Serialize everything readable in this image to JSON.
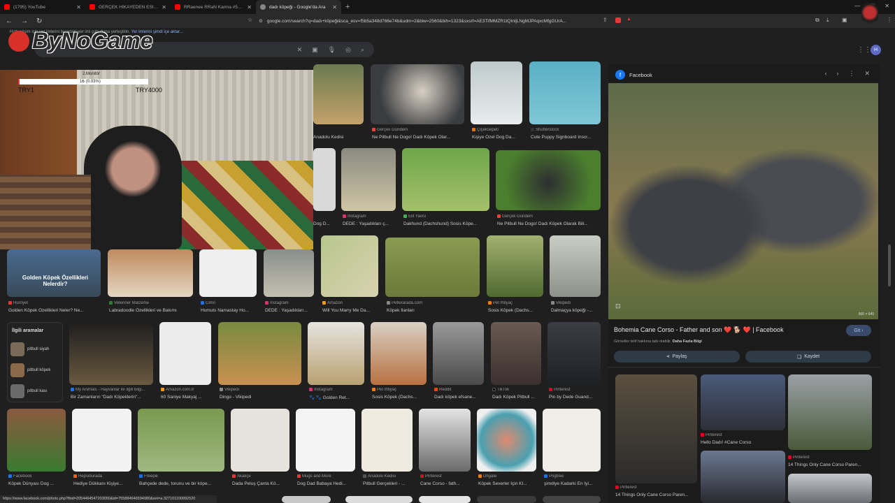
{
  "tabs": [
    {
      "title": "(1795) YouTube",
      "color": "#ff0000"
    },
    {
      "title": "GERÇEK HİKAYEDEN ESİNLENEN TÜRK",
      "color": "#ff0000"
    },
    {
      "title": "RRaenee RRaN Karma #58 İstiyor - YouTube",
      "color": "#ff0000"
    },
    {
      "title": "dadı köpeği - Google'da Ara",
      "color": "#888888",
      "active": true
    }
  ],
  "new_tab": "+",
  "address": {
    "url": "google.com/search?q=dadı+köpeği&sca_esv=f5b5a348d766e74b&udm=2&biw=2560&bih=1323&sxsrf=AE3TifMMZR1tQInljLNgMJPAqxcMfgGUrA..."
  },
  "bookmarks": {
    "text": "Hızlı erişim için yer imlerini buradaki yer imi çubuğuna yerleştirin.",
    "link": "Yer imlerini şimdi içe aktar..."
  },
  "overlay": {
    "logo": "ByNoGame",
    "monitor": "2.Monitör",
    "percent": "1₺ (0.03%)",
    "left": "TRY1",
    "right": "TRY4000"
  },
  "results": [
    {
      "src": "Gerçek Gündem",
      "title": "Ne Pitbull Ne Dogo! Dadı Köpek Olar...",
      "c": "#ea4335"
    },
    {
      "src": "Çiçeksepeti",
      "title": "Kişiye Özel Dog Da...",
      "c": "#e37400"
    },
    {
      "src": "Shutterstock",
      "title": "Cute Puppy Signboard Inscr...",
      "c": "#333"
    },
    {
      "src": "",
      "title": "Anadolu Kedisi",
      "c": "#555"
    },
    {
      "src": "Instagram",
      "title": "DEDE : Yaşadıkları ç...",
      "c": "#e1306c"
    },
    {
      "src": "Elit Yavru",
      "title": "Dakhund (Dachshund) Sosis Köpe...",
      "c": "#4caf50"
    },
    {
      "src": "Gerçek Gündem",
      "title": "Ne Pitbull Ne Dogo! Dadı Köpek Olarak Bili...",
      "c": "#ea4335"
    },
    {
      "src": "",
      "title": "Dog D...",
      "c": "#555"
    },
    {
      "src": "Hürriyet",
      "title": "Golden Köpek Özellikleri Neler? Ne...",
      "c": "#e53935"
    },
    {
      "src": "Veteriner Malzeme",
      "title": "Labradoodle Özellikleri ve Bakımı",
      "c": "#2e7d32"
    },
    {
      "src": "Cimri",
      "title": "Humuts Namastay Ho...",
      "c": "#1a73e8"
    },
    {
      "src": "Instagram",
      "title": "DEDE : Yaşadıkları...",
      "c": "#e1306c"
    },
    {
      "src": "Amazon",
      "title": "Will You Marry Me Da...",
      "c": "#ff9900"
    },
    {
      "src": "Petlerarada.com",
      "title": "Köpek İlanları",
      "c": "#888"
    },
    {
      "src": "Pet İhtiyaç",
      "title": "Sosis Köpek (Dachs...",
      "c": "#f57c00"
    },
    {
      "src": "Vikipedi",
      "title": "Dalmaçya köpeği -...",
      "c": "#888"
    },
    {
      "src": "My Animals - Hayvanlar ile ilgili bilgi...",
      "title": "Bir Zamanların \"Dadı Köpeklerin\"...",
      "c": "#1a73e8"
    },
    {
      "src": "Amazon.com.tr",
      "title": "60 Saniye Makyaj ...",
      "c": "#ff9900"
    },
    {
      "src": "Vikipedi",
      "title": "Dingo - Vikipedi",
      "c": "#888"
    },
    {
      "src": "Instagram",
      "title": "🐾 🐾 Golden Ret...",
      "c": "#e1306c"
    },
    {
      "src": "Pet İhtiyaç",
      "title": "Sosis Köpek (Dachs...",
      "c": "#f57c00"
    },
    {
      "src": "Reddit",
      "title": "Dadı köpek efsane...",
      "c": "#ff4500"
    },
    {
      "src": "TikTok",
      "title": "Dadı Köpek Pitbull ...",
      "c": "#111"
    },
    {
      "src": "Pinterest",
      "title": "Pin by Dede Guand...",
      "c": "#e60023"
    },
    {
      "src": "Facebook",
      "title": "Köpek Dünyası Dog ...",
      "c": "#1877f2"
    },
    {
      "src": "Hepsiburada",
      "title": "Hediye Dükkanı Kişiye...",
      "c": "#ff6000"
    },
    {
      "src": "Freepik",
      "title": "Bahçede dede, torunu ve bir köpe...",
      "c": "#1273eb"
    },
    {
      "src": "Akakçe",
      "title": "Dada Peluş Çanta Kö...",
      "c": "#e53935"
    },
    {
      "src": "Mugs and More",
      "title": "Dog Dad Babaya Hedi...",
      "c": "#e53935"
    },
    {
      "src": "Anadolu Kedisi",
      "title": "Pitbull Gerçekleri - ...",
      "c": "#555"
    },
    {
      "src": "Pinterest",
      "title": "Cane Corso - fath...",
      "c": "#e60023"
    },
    {
      "src": "Dhgate",
      "title": "Köpek Severler İçin Kİ...",
      "c": "#f57c00"
    },
    {
      "src": "Pngtree",
      "title": "şimdiye Kadarki En İyi...",
      "c": "#1a73e8"
    }
  ],
  "golden_overlay": "Golden Köpek Özellikleri Nelerdir?",
  "related": {
    "heading": "İlgili aramalar",
    "items": [
      "pitbull siyah",
      "pitbull köpek",
      "pitbull kası"
    ]
  },
  "panel": {
    "source": "Facebook",
    "title": "Bohemia Cane Corso - Father and son ❤️ 🐕 ❤️ | Facebook",
    "visit": "Git",
    "copyright": "Görseller telif hakkına tabi olabilir.",
    "more": "Daha Fazla Bilgi",
    "size": "960 × 640",
    "share": "Paylaş",
    "save": "Kaydet",
    "related": [
      {
        "src": "Pinterest",
        "title": "14 Things Only Cane Corso Paren..."
      },
      {
        "src": "Pinterest",
        "title": "Hello Dadı! #Cane Corso"
      },
      {
        "src": "Pinterest",
        "title": "14 Things Only Cane Corso Paren..."
      }
    ]
  },
  "status": "https://www.facebook.com/photo.php?fbid=2054464547203050&id=755884646594980&set=a.327101100992520"
}
